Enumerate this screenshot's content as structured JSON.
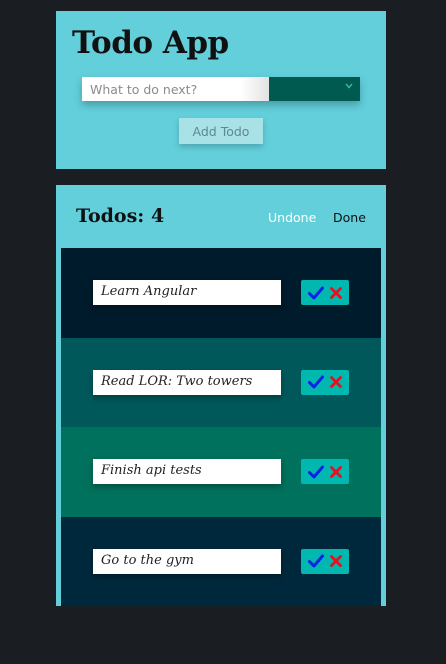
{
  "app": {
    "title": "Todo App"
  },
  "form": {
    "input_placeholder": "What to do next?",
    "input_value": "",
    "filter_selected": "",
    "add_button_label": "Add Todo"
  },
  "list": {
    "count_label": "Todos:",
    "count_value": "4",
    "filters": {
      "undone": "Undone",
      "done": "Done"
    },
    "items": [
      {
        "text": "Learn Angular",
        "bg": "#001b2c"
      },
      {
        "text": "Read LOR: Two towers",
        "bg": "#00585a"
      },
      {
        "text": "Finish api tests",
        "bg": "#00715c"
      },
      {
        "text": "Go to the gym",
        "bg": "#00283c"
      }
    ]
  },
  "colors": {
    "page_bg": "#1a1e23",
    "card_bg": "#62cfdb",
    "select_bg": "#005a50",
    "action_bg": "#00b8b0",
    "check_color": "#0b22e6",
    "delete_color": "#e8101f"
  },
  "icons": {
    "check": "check-icon",
    "delete": "close-icon",
    "dropdown": "chevron-down-icon"
  }
}
